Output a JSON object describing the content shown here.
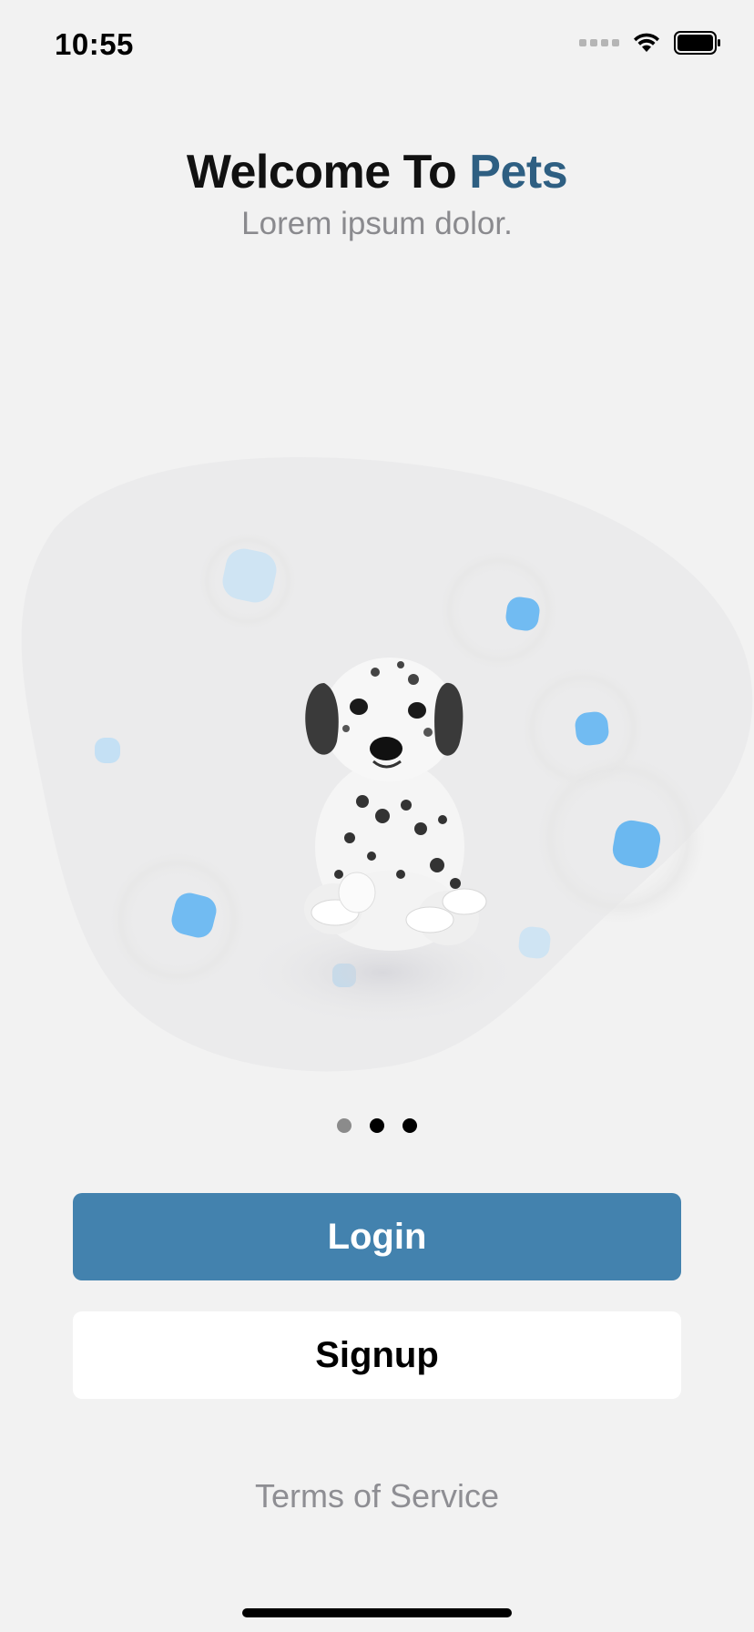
{
  "status_bar": {
    "time": "10:55"
  },
  "header": {
    "title_prefix": "Welcome To ",
    "title_accent": "Pets",
    "subtitle": "Lorem ipsum dolor."
  },
  "hero": {
    "illustration": "dalmatian-puppy"
  },
  "pager": {
    "count": 3,
    "active_index": 0
  },
  "buttons": {
    "login_label": "Login",
    "signup_label": "Signup"
  },
  "footer": {
    "terms_label": "Terms of Service"
  },
  "colors": {
    "background": "#f2f2f2",
    "accent": "#2e5f82",
    "login_button": "#4382ae",
    "bubble": "#6bb8f0"
  }
}
